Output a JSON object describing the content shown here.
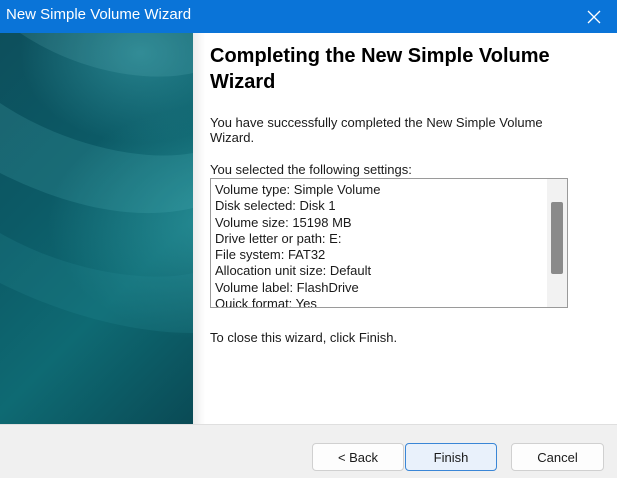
{
  "window": {
    "title": "New Simple Volume Wizard",
    "close_icon": "close-icon",
    "accent_color": "#0a74d8"
  },
  "main": {
    "heading": "Completing the New Simple Volume Wizard",
    "intro": "You have successfully completed the New Simple Volume Wizard.",
    "settings_label": "You selected the following settings:",
    "settings": [
      "Volume type: Simple Volume",
      "Disk selected: Disk 1",
      "Volume size: 15198 MB",
      "Drive letter or path: E:",
      "File system: FAT32",
      "Allocation unit size: Default",
      "Volume label: FlashDrive",
      "Quick format: Yes"
    ],
    "close_hint": "To close this wizard, click Finish."
  },
  "buttons": {
    "back": "< Back",
    "finish": "Finish",
    "cancel": "Cancel"
  }
}
